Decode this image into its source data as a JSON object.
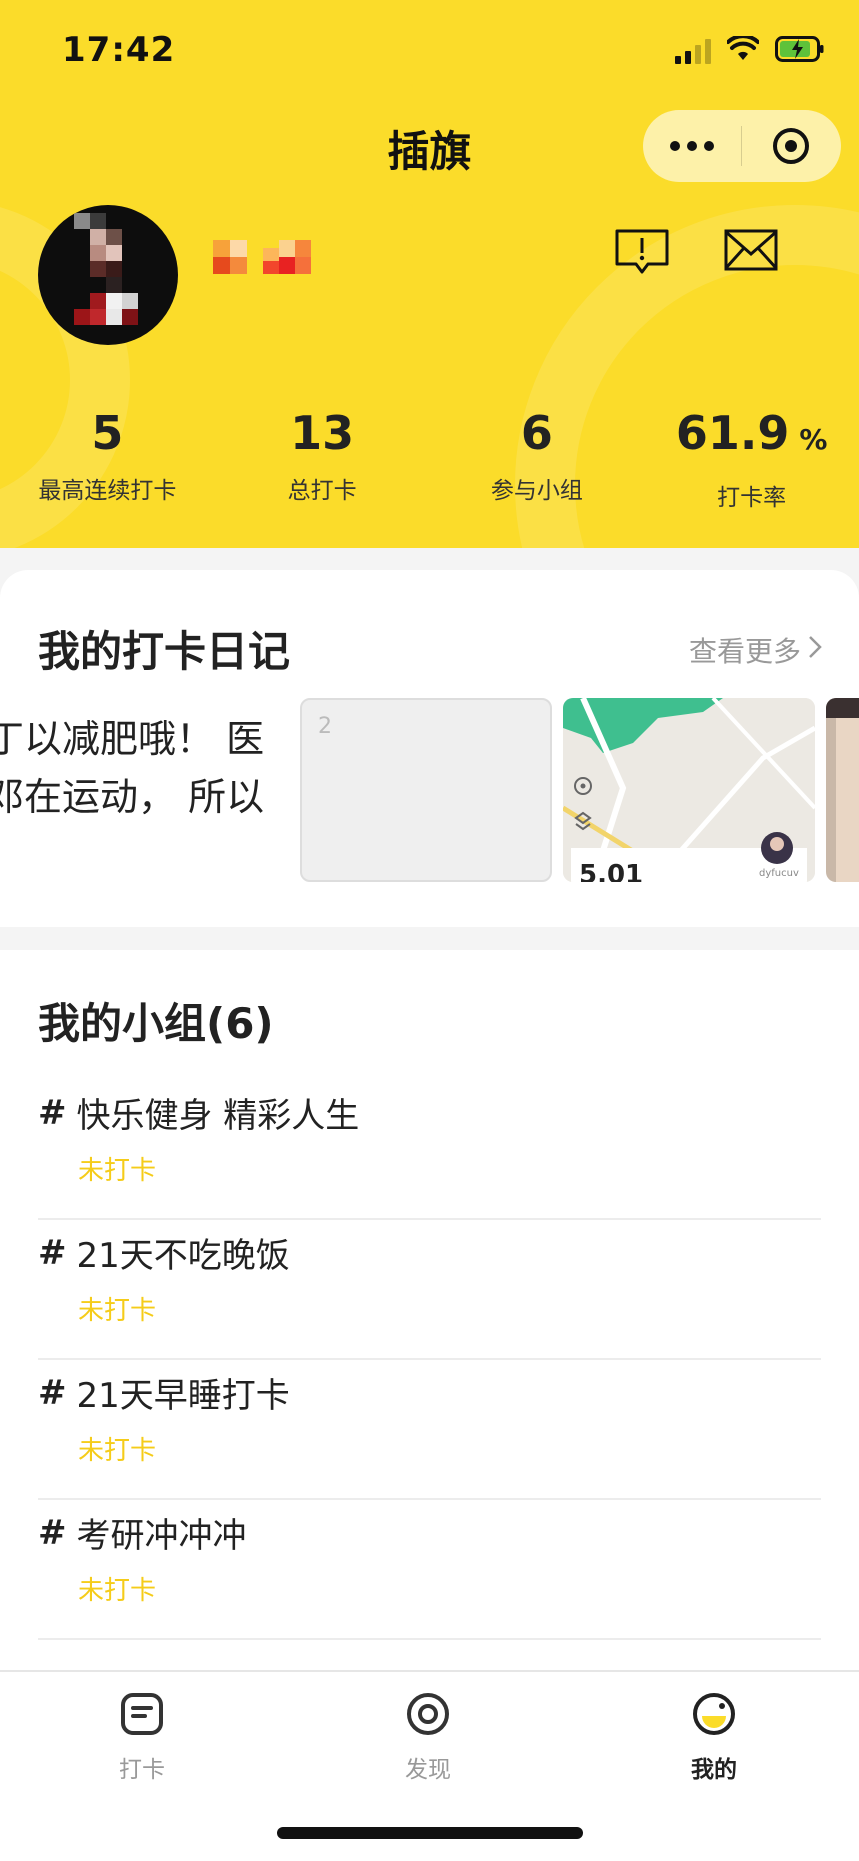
{
  "status_bar": {
    "time": "17:42",
    "icons": [
      "signal-icon",
      "wifi-icon",
      "battery-charging-icon"
    ]
  },
  "nav": {
    "title": "插旗",
    "capsule_icons": [
      "more-icon",
      "close-target-icon"
    ]
  },
  "profile": {
    "header_icons": [
      "report-icon",
      "mail-icon"
    ],
    "stats": [
      {
        "value": "5",
        "unit": "",
        "label": "最高连续打卡"
      },
      {
        "value": "13",
        "unit": "",
        "label": "总打卡"
      },
      {
        "value": "6",
        "unit": "",
        "label": "参与小组"
      },
      {
        "value": "61.9",
        "unit": "%",
        "label": "打卡率"
      }
    ]
  },
  "diary": {
    "title": "我的打卡日记",
    "see_more": "查看更多",
    "text_lines": [
      "丁以减肥哦！ 医",
      "邓在运动， 所以"
    ],
    "placeholder_number": "2",
    "map_card": {
      "distance": "5.01",
      "user": "dyfucuv"
    }
  },
  "groups": {
    "title": "我的小组(6)",
    "items": [
      {
        "name": "快乐健身 精彩人生",
        "status": "未打卡"
      },
      {
        "name": "21天不吃晚饭",
        "status": "未打卡"
      },
      {
        "name": "21天早睡打卡",
        "status": "未打卡"
      },
      {
        "name": "考研冲冲冲",
        "status": "未打卡"
      }
    ]
  },
  "tab_bar": {
    "tabs": [
      {
        "label": "打卡",
        "icon": "checkin-icon",
        "active": false
      },
      {
        "label": "发现",
        "icon": "discover-icon",
        "active": false
      },
      {
        "label": "我的",
        "icon": "me-icon",
        "active": true
      }
    ]
  },
  "colors": {
    "brand_yellow": "#fbdc2a",
    "status_yellow": "#f5cc1a",
    "text_dark": "#222222",
    "text_muted": "#999999"
  }
}
